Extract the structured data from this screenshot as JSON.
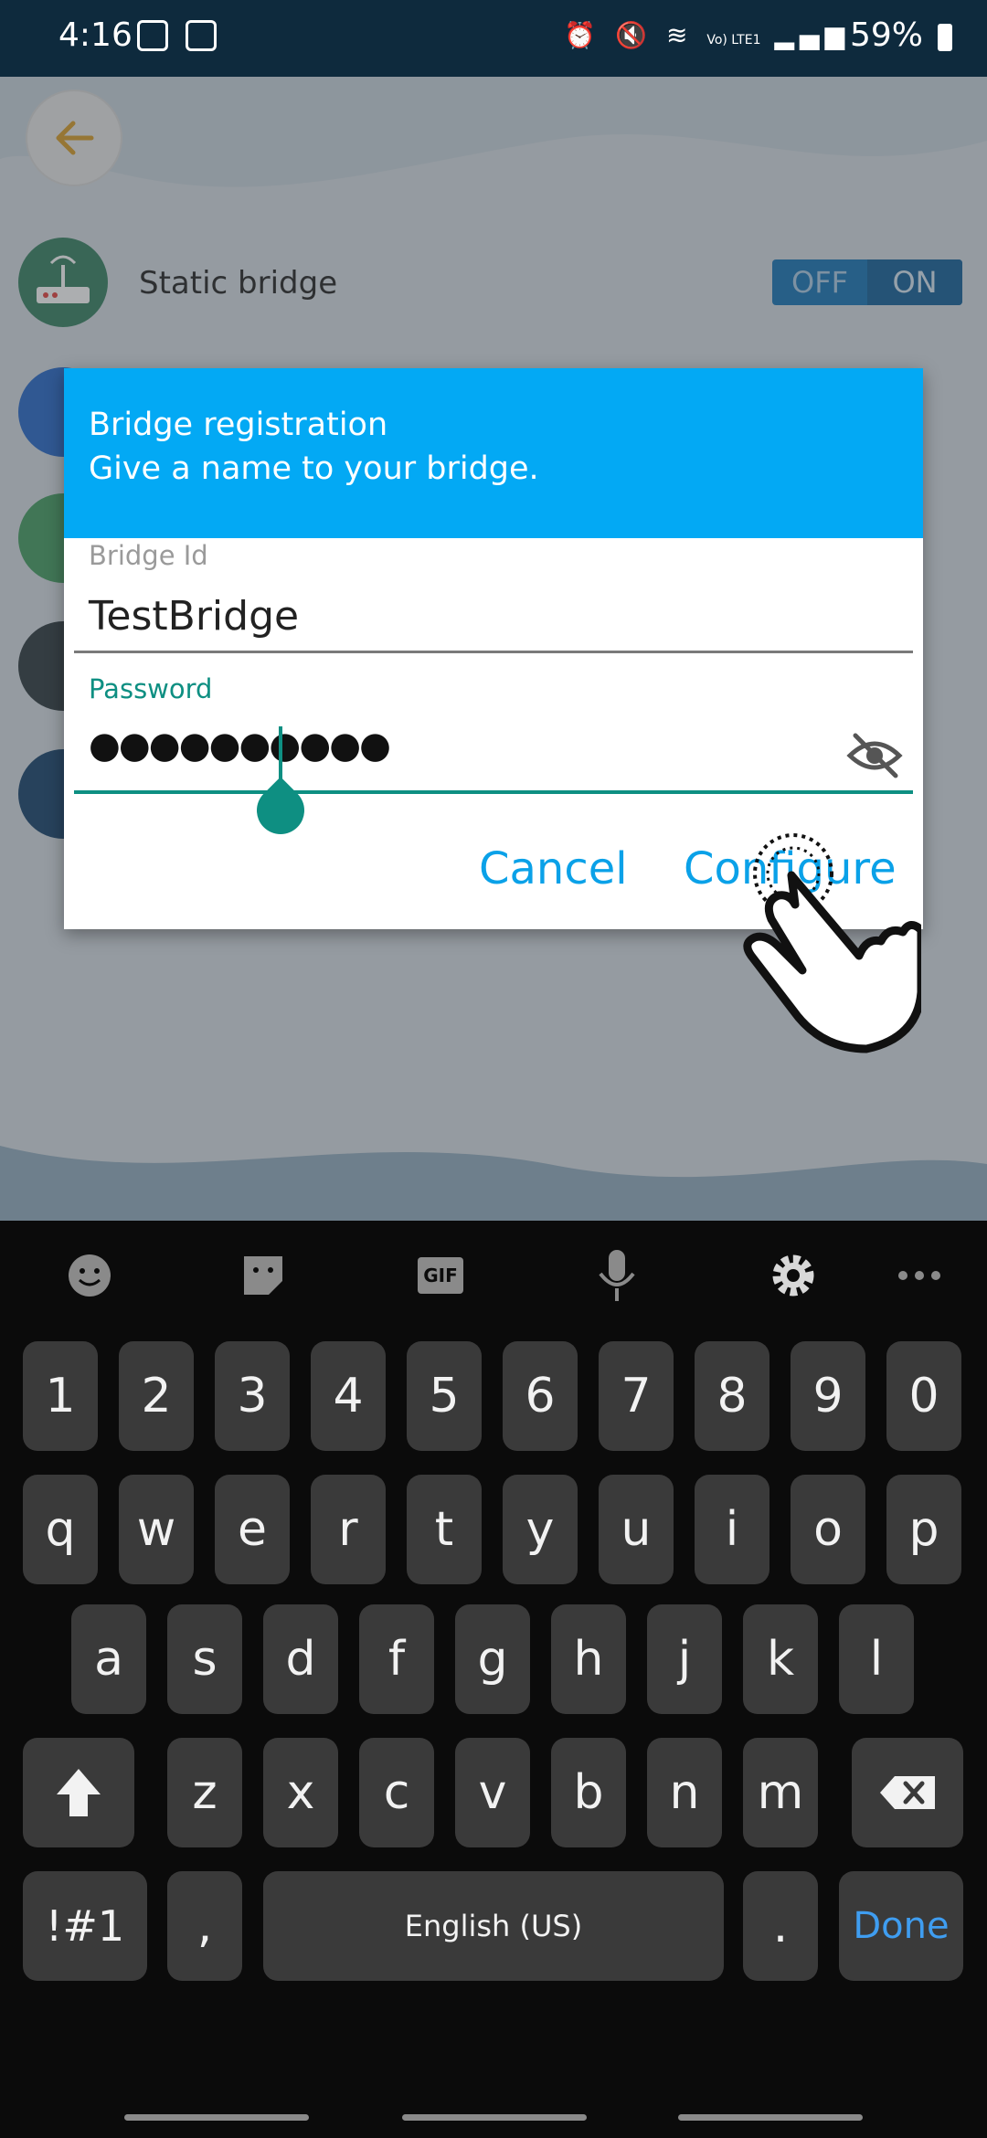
{
  "status_bar": {
    "time": "4:16",
    "signal_text": "Vo) LTE1",
    "battery": "59%"
  },
  "app": {
    "list_item_label": "Static bridge",
    "toggle": {
      "off_label": "OFF",
      "on_label": "ON",
      "state": "off"
    }
  },
  "dialog": {
    "title": "Bridge registration",
    "subtitle": "Give a name to your bridge.",
    "bridge_id_label": "Bridge Id",
    "bridge_id_value": "TestBridge",
    "password_label": "Password",
    "password_mask": "●●●●●●●●●●",
    "cancel_label": "Cancel",
    "configure_label": "Configure"
  },
  "keyboard": {
    "number_row": [
      "1",
      "2",
      "3",
      "4",
      "5",
      "6",
      "7",
      "8",
      "9",
      "0"
    ],
    "row1": [
      "q",
      "w",
      "e",
      "r",
      "t",
      "y",
      "u",
      "i",
      "o",
      "p"
    ],
    "row2": [
      "a",
      "s",
      "d",
      "f",
      "g",
      "h",
      "j",
      "k",
      "l"
    ],
    "row3": [
      "z",
      "x",
      "c",
      "v",
      "b",
      "n",
      "m"
    ],
    "symbols_label": "!#1",
    "comma_label": ",",
    "space_label": "English (US)",
    "period_label": ".",
    "done_label": "Done",
    "gif_label": "GIF"
  },
  "colors": {
    "dialog_header": "#03a9f4",
    "accent_teal": "#0e8f82",
    "button_blue": "#0aa1e8",
    "done_blue": "#3f9df0"
  }
}
